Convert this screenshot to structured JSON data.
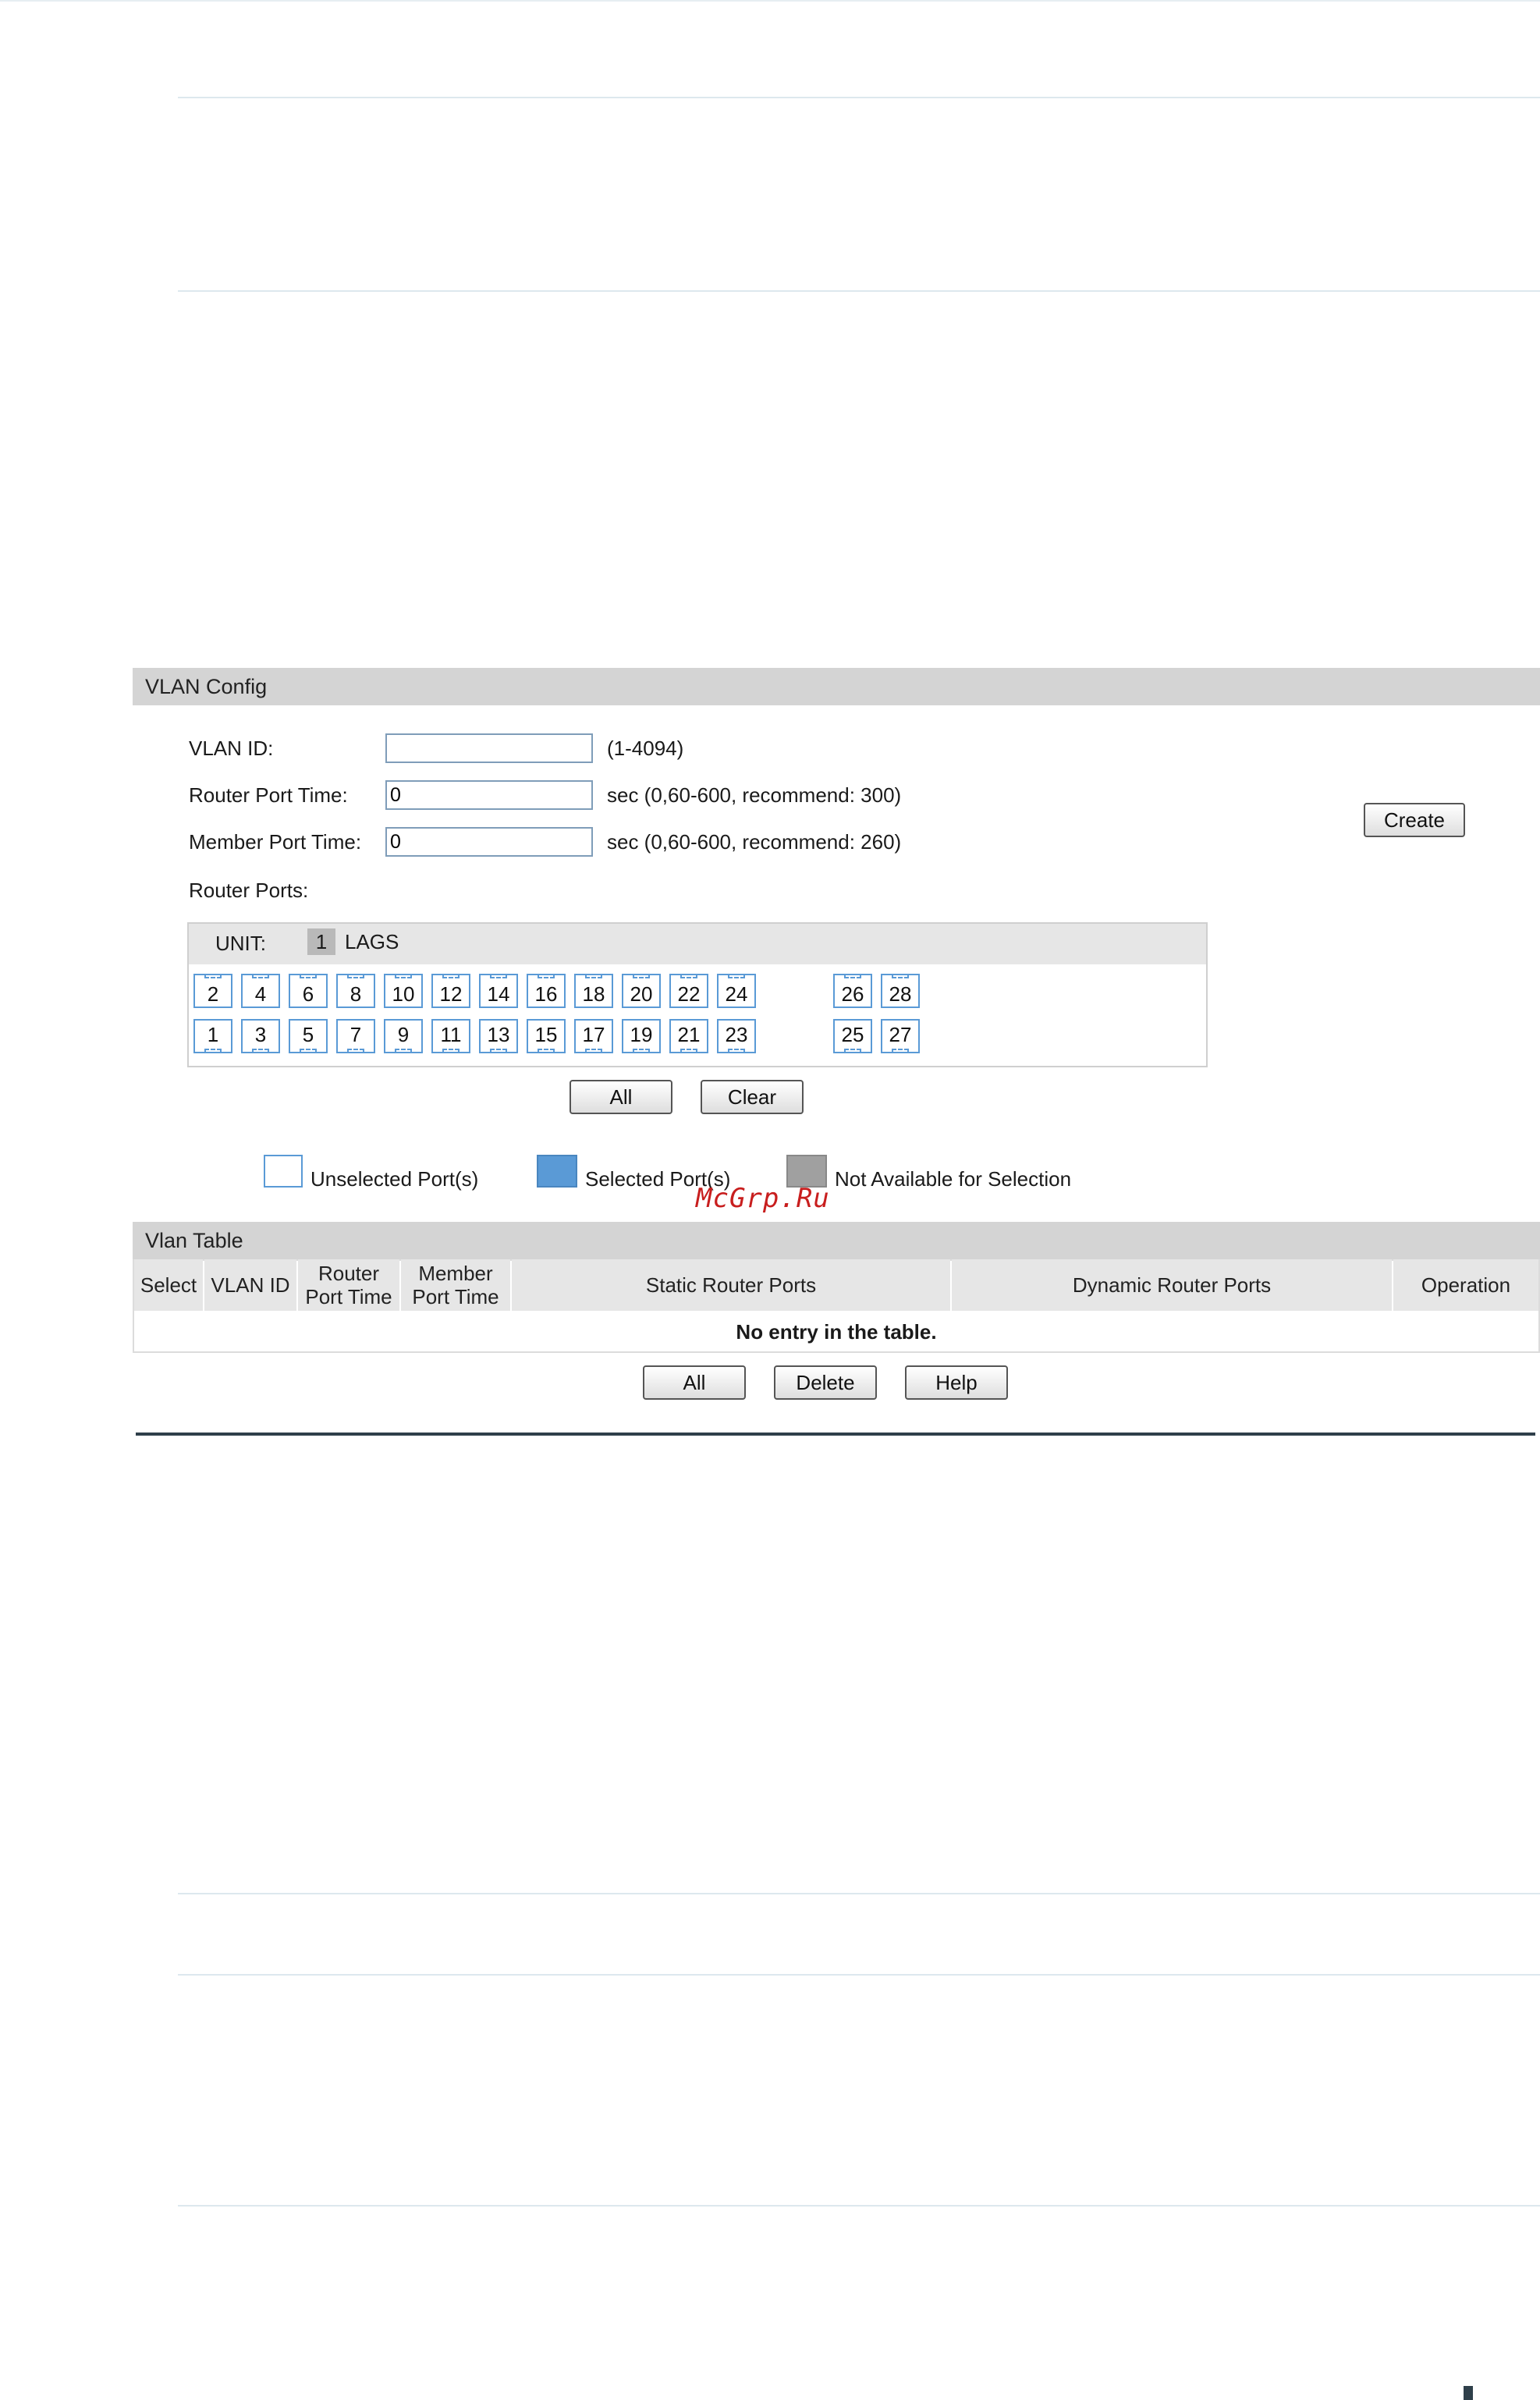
{
  "vlan_config": {
    "title": "VLAN Config",
    "vlan_id_label": "VLAN ID:",
    "vlan_id_value": "",
    "vlan_id_hint": "(1-4094)",
    "router_port_time_label": "Router Port Time:",
    "router_port_time_value": "0",
    "router_port_time_hint": "sec (0,60-600, recommend: 300)",
    "member_port_time_label": "Member Port Time:",
    "member_port_time_value": "0",
    "member_port_time_hint": "sec (0,60-600, recommend: 260)",
    "router_ports_label": "Router Ports:",
    "create_button": "Create"
  },
  "port_panel": {
    "unit_label": "UNIT:",
    "unit_value": "1",
    "lags_label": "LAGS",
    "top_ports": [
      "2",
      "4",
      "6",
      "8",
      "10",
      "12",
      "14",
      "16",
      "18",
      "20",
      "22",
      "24"
    ],
    "bottom_ports": [
      "1",
      "3",
      "5",
      "7",
      "9",
      "11",
      "13",
      "15",
      "17",
      "19",
      "21",
      "23"
    ],
    "top_extra": [
      "26",
      "28"
    ],
    "bottom_extra": [
      "25",
      "27"
    ],
    "all_button": "All",
    "clear_button": "Clear"
  },
  "legend": {
    "unselected": "Unselected Port(s)",
    "selected": "Selected Port(s)",
    "not_available": "Not Available for Selection",
    "colors": {
      "unselected": "#ffffff",
      "selected": "#5a9ad6",
      "not_available": "#a0a0a0"
    }
  },
  "watermark": "McGrp.Ru",
  "vlan_table": {
    "title": "Vlan Table",
    "columns": [
      "Select",
      "VLAN ID",
      "Router Port Time",
      "Member Port Time",
      "Static Router Ports",
      "Dynamic Router Ports",
      "Operation"
    ],
    "empty_message": "No entry in the table.",
    "all_button": "All",
    "delete_button": "Delete",
    "help_button": "Help"
  }
}
